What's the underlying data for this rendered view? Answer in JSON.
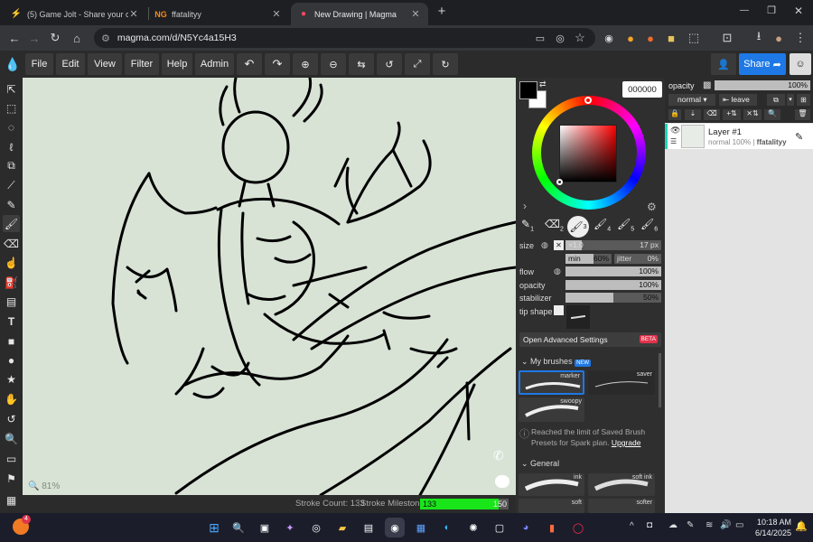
{
  "browser": {
    "tabs": [
      {
        "icon": "gamejolt-icon",
        "title": "(5) Game Jolt - Share your crea"
      },
      {
        "icon": "newgrounds-icon",
        "title": "ffatalityy"
      },
      {
        "icon": "magma-icon",
        "title": "New Drawing | Magma"
      }
    ],
    "url": "magma.com/d/N5Yc4a15H3"
  },
  "menu": [
    "File",
    "Edit",
    "View",
    "Filter",
    "Help",
    "Admin"
  ],
  "share_label": "Share",
  "canvas": {
    "zoom": "81%",
    "bg_color": "#d8e3d6"
  },
  "status": {
    "stroke_count_label": "Stroke Count: 133",
    "milestone_label": "Stroke Milestone:",
    "milestone_value": "133",
    "milestone_max": "150",
    "milestone_progress": 0.8867
  },
  "color": {
    "hex": "000000",
    "primary": "#000000",
    "secondary": "#ffffff"
  },
  "brush": {
    "slots": [
      "1",
      "2",
      "3",
      "4",
      "5",
      "6"
    ],
    "size_label": "size",
    "size_mult": "×1.0",
    "size_value": "17 px",
    "size_fraction": 0.17,
    "min_label": "min",
    "min_value": "60%",
    "min_fraction": 0.6,
    "jitter_label": "jitter",
    "jitter_value": "0%",
    "jitter_fraction": 0.0,
    "flow_label": "flow",
    "flow_value": "100%",
    "flow_fraction": 1.0,
    "opacity_label": "opacity",
    "opacity_value": "100%",
    "opacity_fraction": 1.0,
    "stabilizer_label": "stabilizer",
    "stabilizer_value": "50%",
    "stabilizer_fraction": 0.5,
    "tip_label": "tip shape",
    "advanced_label": "Open Advanced Settings",
    "advanced_badge": "BETA",
    "my_brushes_label": "My brushes",
    "my_brushes_badge": "NEW",
    "my_brushes": [
      "marker",
      "saver",
      "swoopy"
    ],
    "limit_text": "Reached the limit of Saved Brush Presets for Spark plan.",
    "upgrade_label": "Upgrade",
    "general_label": "General",
    "general_brushes": [
      "ink",
      "soft ink",
      "soft",
      "softer"
    ]
  },
  "layers": {
    "opacity_label": "opacity",
    "opacity_value": "100%",
    "opacity_fraction": 1.0,
    "blend_mode": "normal",
    "leave_label": "leave",
    "items": [
      {
        "name": "Layer #1",
        "meta": "normal 100% | ",
        "owner": "ffatalityy"
      }
    ]
  },
  "taskbar": {
    "time": "10:18 AM",
    "date": "6/14/2025",
    "badge": "4"
  }
}
